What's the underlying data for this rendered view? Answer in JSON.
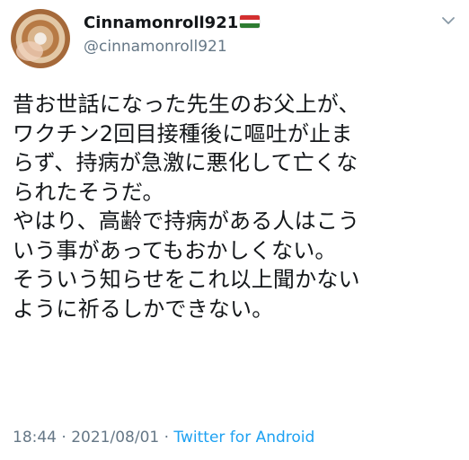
{
  "author": {
    "display_name": "Cinnamonroll921",
    "handle": "@cinnamonroll921",
    "flag_icon": "hungary-flag-icon",
    "avatar_icon": "cinnamon-roll-avatar"
  },
  "tweet": {
    "lines": [
      "昔お世話になった先生のお父上が、",
      "ワクチン2回目接種後に嘔吐が止ま",
      "らず、持病が急激に悪化して亡くな",
      "られたそうだ。",
      "やはり、高齢で持病がある人はこう",
      "いう事があってもおかしくない。",
      "そういう知らせをこれ以上聞かない",
      "ように祈るしかできない。"
    ]
  },
  "meta": {
    "time": "18:44",
    "separator": " · ",
    "date": "2021/08/01",
    "source": "Twitter for Android"
  },
  "colors": {
    "text": "#14171a",
    "secondary": "#657786",
    "link": "#1da1f2"
  }
}
